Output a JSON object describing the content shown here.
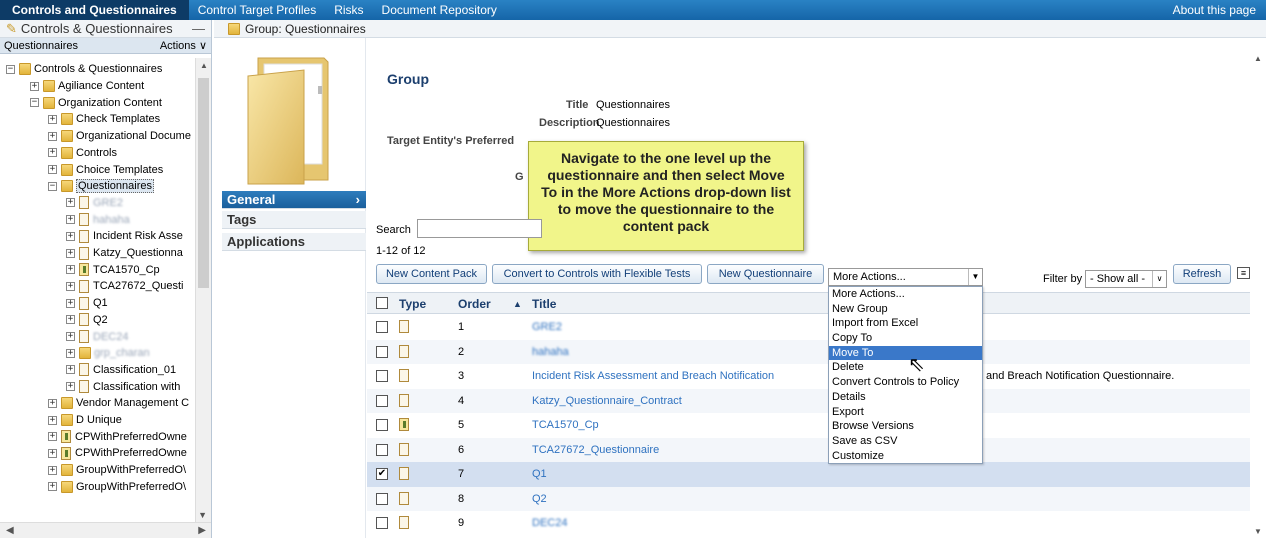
{
  "topnav": {
    "tabs": [
      "Controls and Questionnaires",
      "Control Target Profiles",
      "Risks",
      "Document Repository"
    ],
    "about": "About this page"
  },
  "left_panel": {
    "title": "Controls & Questionnaires",
    "collapse": "—",
    "section": "Questionnaires",
    "actions": "Actions ∨",
    "tree": [
      {
        "label": "Controls & Questionnaires",
        "toggle": "−",
        "icon": "folder-icon"
      },
      {
        "label": "Agiliance Content",
        "toggle": "+",
        "icon": "folder-icon"
      },
      {
        "label": "Organization Content",
        "toggle": "−",
        "icon": "folder-icon"
      },
      {
        "label": "Check Templates",
        "toggle": "+",
        "icon": "folder-icon"
      },
      {
        "label": "Organizational Docume",
        "toggle": "+",
        "icon": "folder-icon"
      },
      {
        "label": "Controls",
        "toggle": "+",
        "icon": "folder-icon"
      },
      {
        "label": "Choice Templates",
        "toggle": "+",
        "icon": "folder-icon"
      },
      {
        "label": "Questionnaires",
        "toggle": "−",
        "icon": "folder-icon"
      },
      {
        "label": "GRE2",
        "toggle": "+",
        "icon": "document-icon",
        "blurred": true
      },
      {
        "label": "hahaha",
        "toggle": "+",
        "icon": "document-icon",
        "blurred": true
      },
      {
        "label": "Incident Risk Asse",
        "toggle": "+",
        "icon": "document-icon"
      },
      {
        "label": "Katzy_Questionna",
        "toggle": "+",
        "icon": "document-icon"
      },
      {
        "label": "TCA1570_Cp",
        "toggle": "+",
        "icon": "content-pack-icon"
      },
      {
        "label": "TCA27672_Questi",
        "toggle": "+",
        "icon": "document-icon"
      },
      {
        "label": "Q1",
        "toggle": "+",
        "icon": "document-icon"
      },
      {
        "label": "Q2",
        "toggle": "+",
        "icon": "document-icon"
      },
      {
        "label": "DEC24",
        "toggle": "+",
        "icon": "document-icon",
        "blurred": true
      },
      {
        "label": "grp_charan",
        "toggle": "+",
        "icon": "folder-icon",
        "blurred": true
      },
      {
        "label": "Classification_01",
        "toggle": "+",
        "icon": "document-icon"
      },
      {
        "label": "Classification with",
        "toggle": "+",
        "icon": "document-icon"
      },
      {
        "label": "Vendor Management C",
        "toggle": "+",
        "icon": "folder-icon"
      },
      {
        "label": "D Unique",
        "toggle": "+",
        "icon": "folder-icon"
      },
      {
        "label": "CPWithPreferredOwne",
        "toggle": "+",
        "icon": "content-pack-icon"
      },
      {
        "label": "CPWithPreferredOwne",
        "toggle": "+",
        "icon": "content-pack-icon"
      },
      {
        "label": "GroupWithPreferredO\\",
        "toggle": "+",
        "icon": "folder-icon"
      },
      {
        "label": "GroupWithPreferredO\\",
        "toggle": "+",
        "icon": "folder-icon"
      }
    ]
  },
  "breadcrumb": "Group: Questionnaires",
  "side_nav": [
    "General",
    "Tags",
    "Applications"
  ],
  "group": {
    "heading": "Group",
    "title_label": "Title",
    "title_value": "Questionnaires",
    "desc_label": "Description",
    "desc_value": "Questionnaires",
    "target_label": "Target Entity's Preferred",
    "partial_label": "G"
  },
  "callout": "Navigate to the one level up the questionnaire and then select Move To in the More Actions drop-down list to move the questionnaire to the content pack",
  "search_label": "Search",
  "count": "1-12 of 12",
  "buttons": {
    "new_content_pack": "New Content Pack",
    "convert": "Convert to Controls with Flexible Tests",
    "new_questionnaire": "New Questionnaire",
    "refresh": "Refresh"
  },
  "more_actions": {
    "selected": "More Actions...",
    "options": [
      "More Actions...",
      "New Group",
      "Import from Excel",
      "Copy To",
      "Move To",
      "Delete",
      "Convert Controls to Policy",
      "Details",
      "Export",
      "Browse Versions",
      "Save as CSV",
      "Customize"
    ],
    "highlighted": "Move To"
  },
  "filter": {
    "label": "Filter by",
    "selected": "- Show all -"
  },
  "table": {
    "columns": [
      "Type",
      "Order",
      "Title"
    ],
    "sort_indicator": "▲",
    "rows": [
      {
        "order": "1",
        "title": "GRE2",
        "blurred": true,
        "icon": "document-icon",
        "checked": false
      },
      {
        "order": "2",
        "title": "hahaha",
        "blurred": true,
        "icon": "document-icon",
        "checked": false
      },
      {
        "order": "3",
        "title": "Incident Risk Assessment and Breach Notification",
        "desc": "and Breach Notification Questionnaire.",
        "icon": "document-icon",
        "checked": false
      },
      {
        "order": "4",
        "title": "Katzy_Questionnaire_Contract",
        "icon": "document-icon",
        "checked": false
      },
      {
        "order": "5",
        "title": "TCA1570_Cp",
        "icon": "content-pack-icon",
        "checked": false
      },
      {
        "order": "6",
        "title": "TCA27672_Questionnaire",
        "icon": "document-icon",
        "checked": false
      },
      {
        "order": "7",
        "title": "Q1",
        "icon": "document-icon",
        "checked": true
      },
      {
        "order": "8",
        "title": "Q2",
        "icon": "document-icon",
        "checked": false
      },
      {
        "order": "9",
        "title": "DEC24",
        "blurred": true,
        "icon": "document-icon",
        "checked": false
      }
    ]
  },
  "colors": {
    "nav_blue": "#1565a8",
    "link_blue": "#2f72c0",
    "callout_yellow": "#f1f58a",
    "menu_highlight": "#3a78c9"
  }
}
